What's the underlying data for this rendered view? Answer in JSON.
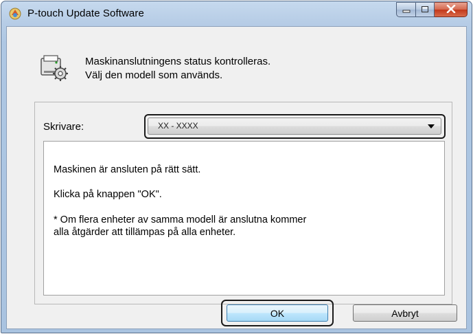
{
  "window": {
    "title": "P-touch Update Software"
  },
  "header": {
    "line1": "Maskinanslutningens status kontrolleras.",
    "line2": "Välj den modell som används."
  },
  "printer": {
    "label": "Skrivare:",
    "selected_value": "XX - XXXX"
  },
  "message": {
    "line1": "Maskinen är ansluten på rätt sätt.",
    "line2": "Klicka på knappen \"OK\".",
    "line3": "* Om flera enheter av samma modell är anslutna kommer",
    "line4": "alla åtgärder att tillämpas på alla enheter."
  },
  "buttons": {
    "ok_label": "OK",
    "cancel_label": "Avbryt"
  },
  "icons": {
    "app": "ptouch-app-icon",
    "header": "printer-settings-icon",
    "minimize": "minimize-icon",
    "maximize": "maximize-icon",
    "close": "close-icon",
    "dropdown": "chevron-down-icon"
  },
  "colors": {
    "title_bar": "#b7cde6",
    "client_bg": "#f0f0f0",
    "close_button": "#c2381b",
    "default_button": "#bee6fd"
  }
}
